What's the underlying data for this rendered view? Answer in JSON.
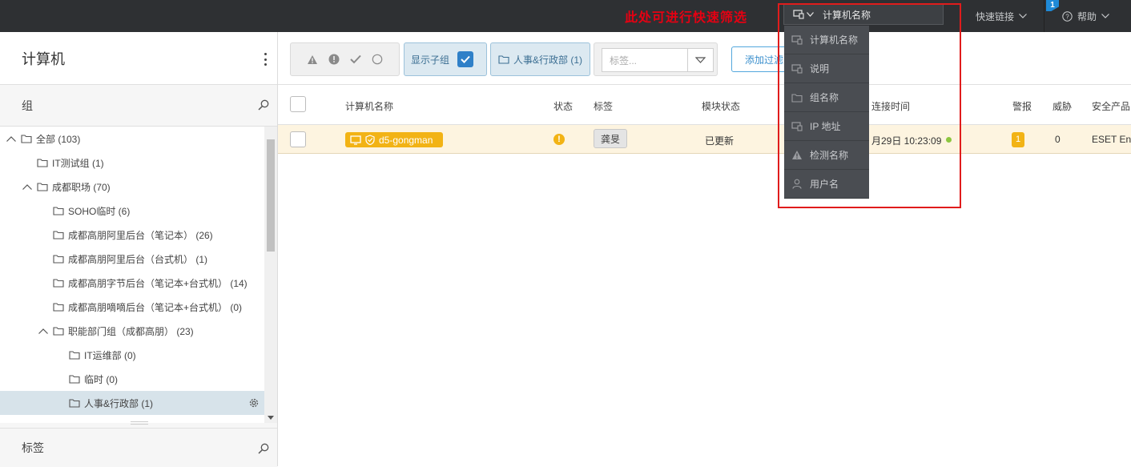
{
  "topbar": {
    "annotation": "此处可进行快速筛选",
    "search_value": "计算机名称",
    "quick_links": "快速链接",
    "help": "帮助",
    "notification_count": "1"
  },
  "sidebar": {
    "title": "计算机",
    "groups_label": "组",
    "tags_label": "标签",
    "tree": [
      {
        "label": "全部 (103)",
        "level": 0,
        "expanded": true
      },
      {
        "label": "IT测试组 (1)",
        "level": 1,
        "expanded": null
      },
      {
        "label": "成都职场 (70)",
        "level": 1,
        "expanded": true
      },
      {
        "label": "SOHO临时 (6)",
        "level": 2,
        "expanded": null
      },
      {
        "label": "成都高朋阿里后台（笔记本） (26)",
        "level": 2,
        "expanded": null
      },
      {
        "label": "成都高朋阿里后台（台式机） (1)",
        "level": 2,
        "expanded": null
      },
      {
        "label": "成都高朋字节后台（笔记本+台式机） (14)",
        "level": 2,
        "expanded": null
      },
      {
        "label": "成都高朋嘀嘀后台（笔记本+台式机） (0)",
        "level": 2,
        "expanded": null
      },
      {
        "label": "职能部门组（成都高朋） (23)",
        "level": 2,
        "expanded": true
      },
      {
        "label": "IT运维部 (0)",
        "level": 3,
        "expanded": null
      },
      {
        "label": "临时 (0)",
        "level": 3,
        "expanded": null
      },
      {
        "label": "人事&行政部 (1)",
        "level": 3,
        "expanded": null,
        "selected": true
      }
    ]
  },
  "toolbar": {
    "show_subgroups": "显示子组",
    "group_filter": "人事&行政部 (1)",
    "tags_placeholder": "标签...",
    "add_filter": "添加过滤"
  },
  "table": {
    "columns": {
      "name": "计算机名称",
      "status": "状态",
      "tags": "标签",
      "module_status": "模块状态",
      "last_connected": "连接时间",
      "alerts": "警报",
      "threats": "威胁",
      "security_product": "安全产品"
    },
    "rows": [
      {
        "name": "d5-gongman",
        "status_icon": "warning",
        "tag": "龚旻",
        "module_status": "已更新",
        "last_connected": "月29日 10:23:09",
        "alerts": "1",
        "threats": "0",
        "security_product": "ESET End"
      }
    ]
  },
  "dropdown": {
    "items": [
      {
        "label": "计算机名称",
        "icon": "computer-icon"
      },
      {
        "label": "说明",
        "icon": "computer-icon"
      },
      {
        "label": "组名称",
        "icon": "folder-icon"
      },
      {
        "label": "IP 地址",
        "icon": "computer-icon"
      },
      {
        "label": "检测名称",
        "icon": "warning-icon"
      },
      {
        "label": "用户名",
        "icon": "user-icon"
      }
    ]
  },
  "colors": {
    "topbar": "#2e3033",
    "accent": "#2f80c8",
    "warning": "#f2b315",
    "annotation": "#e01c1c",
    "row_highlight": "#fdf4e0"
  }
}
